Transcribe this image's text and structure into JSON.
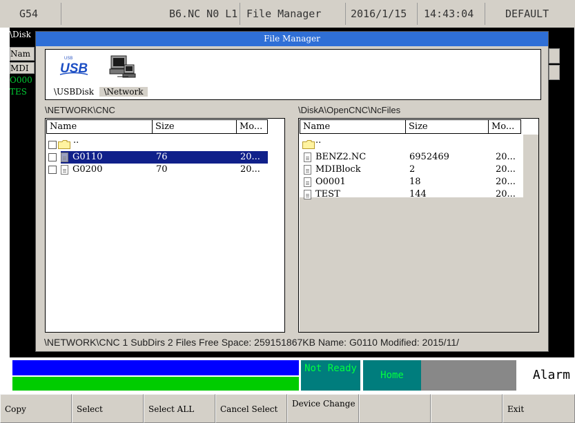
{
  "top_bar": {
    "coordinate_system": "G54",
    "program_info": "B6.NC N0 L1",
    "screen_name": "File Manager",
    "date": "2016/1/15",
    "time": "14:43:04",
    "profile": "DEFAULT"
  },
  "background": {
    "path_fragment": "\\Disk",
    "header_fragment": "Nam",
    "item_fragment": "MDI",
    "row1_fragment": "O000",
    "row2_fragment": "TES"
  },
  "dialog": {
    "title": "File Manager",
    "devices": [
      {
        "label": "\\USBDisk",
        "icon": "usb-icon",
        "selected": false
      },
      {
        "label": "\\Network",
        "icon": "network-computer-icon",
        "selected": true
      }
    ],
    "left_panel": {
      "path": "\\NETWORK\\CNC",
      "columns": [
        "Name",
        "Size",
        "Mo..."
      ],
      "rows": [
        {
          "type": "folder",
          "name": "..",
          "size": "",
          "modified": "",
          "selected": false
        },
        {
          "type": "file",
          "name": "G0110",
          "size": "76",
          "modified": "20...",
          "selected": true
        },
        {
          "type": "file",
          "name": "G0200",
          "size": "70",
          "modified": "20...",
          "selected": false
        }
      ]
    },
    "right_panel": {
      "path": "\\DiskA\\OpenCNC\\NcFiles",
      "columns": [
        "Name",
        "Size",
        "Mo..."
      ],
      "rows": [
        {
          "type": "folder",
          "name": "..",
          "size": "",
          "modified": ""
        },
        {
          "type": "file",
          "name": "BENZ2.NC",
          "size": "6952469",
          "modified": "20..."
        },
        {
          "type": "file",
          "name": "MDIBlock",
          "size": "2",
          "modified": "20..."
        },
        {
          "type": "file",
          "name": "O0001",
          "size": "18",
          "modified": "20..."
        },
        {
          "type": "file",
          "name": "TEST",
          "size": "144",
          "modified": "20..."
        }
      ]
    },
    "status_line": "\\NETWORK\\CNC 1 SubDirs 2 Files Free Space: 259151867KB    Name: G0110 Modified: 2015/11/"
  },
  "machine_status": {
    "ready_state": "Not Ready",
    "mode": "Home",
    "alarm": "Alarm",
    "colors": {
      "bar_top": "#0000ff",
      "bar_bottom": "#00cc00",
      "status_bg": "#007d7d",
      "status_text": "#00ff40"
    }
  },
  "softkeys": [
    "Copy",
    "Select",
    "Select ALL",
    "Cancel Select",
    "Device Change",
    "",
    "",
    "Exit"
  ]
}
